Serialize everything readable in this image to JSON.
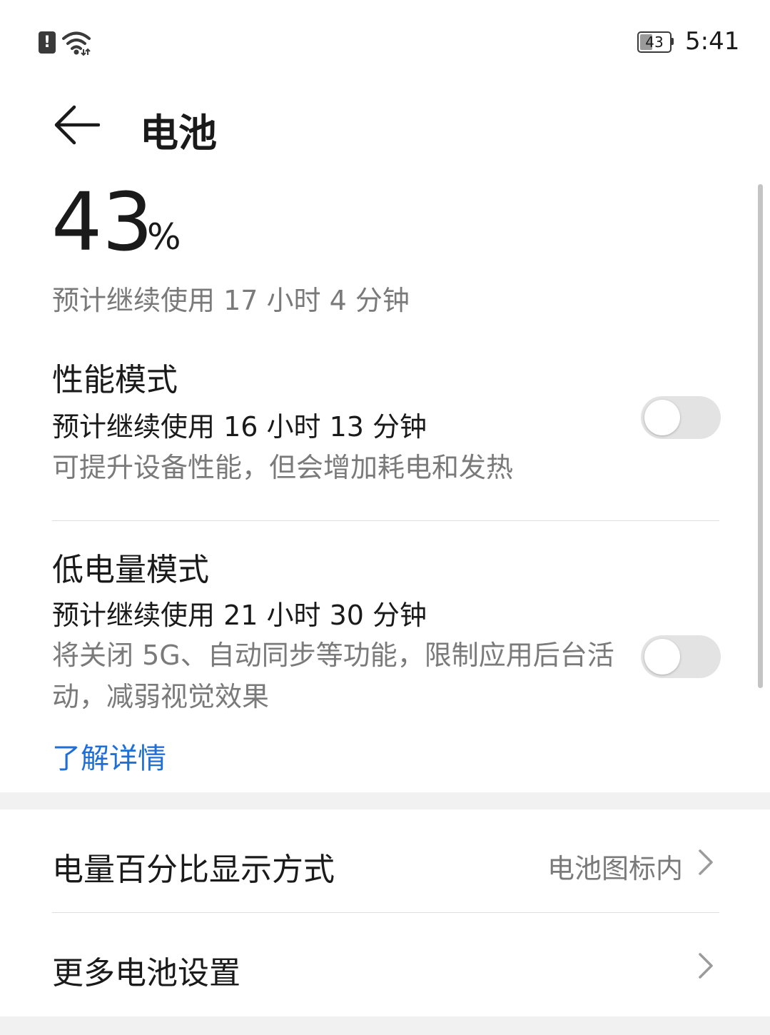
{
  "status_bar": {
    "alert_icon": "!",
    "battery_level": 43,
    "battery_text": "43",
    "time": "5:41"
  },
  "header": {
    "title": "电池"
  },
  "battery": {
    "percent": "43",
    "unit": "%",
    "remaining": "预计继续使用 17 小时 4 分钟"
  },
  "performance_mode": {
    "title": "性能模式",
    "estimate": "预计继续使用 16 小时 13 分钟",
    "description": "可提升设备性能，但会增加耗电和发热",
    "enabled": false
  },
  "low_power_mode": {
    "title": "低电量模式",
    "estimate": "预计继续使用 21 小时 30 分钟",
    "description": "将关闭 5G、自动同步等功能，限制应用后台活动，减弱视觉效果",
    "enabled": false,
    "learn_more": "了解详情"
  },
  "settings": {
    "percentage_display_label": "电量百分比显示方式",
    "percentage_display_value": "电池图标内",
    "more_settings_label": "更多电池设置"
  },
  "colors": {
    "link": "#1f6fd9",
    "secondary_text": "#7a7a7a",
    "toggle_off": "#e3e3e3"
  },
  "icons": {
    "back": "back-arrow-icon",
    "wifi": "wifi-icon",
    "chevron": "chevron-right-icon"
  }
}
